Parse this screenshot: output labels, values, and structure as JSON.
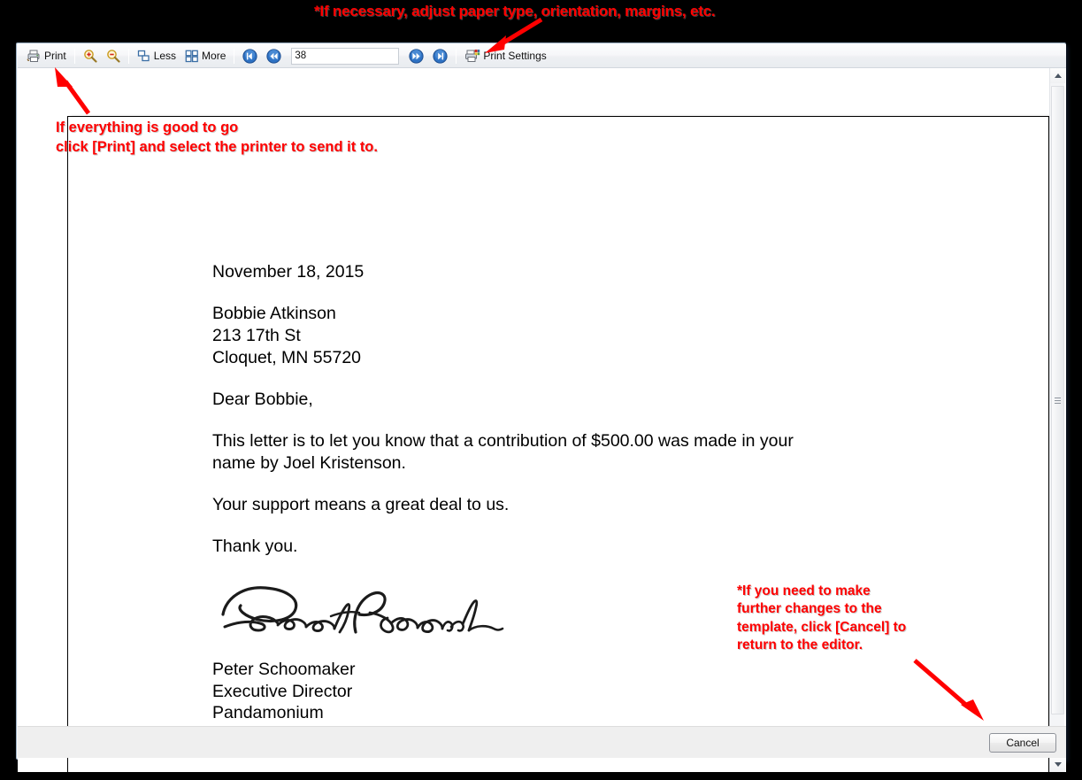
{
  "annotations": {
    "top": "*If necessary, adjust paper type, orientation, margins, etc.",
    "print": "If everything is good to go\nclick [Print] and select the printer to send it to.",
    "cancel": "*If you need to make\nfurther changes to the\ntemplate, click [Cancel] to\nreturn to the editor.",
    "color": "#ff0000"
  },
  "toolbar": {
    "print_label": "Print",
    "zoom_in_icon": "zoom-in-icon",
    "zoom_out_icon": "zoom-out-icon",
    "less_label": "Less",
    "more_label": "More",
    "first_page_icon": "first-page-icon",
    "prev_page_icon": "previous-page-icon",
    "next_page_icon": "next-page-icon",
    "last_page_icon": "last-page-icon",
    "page_number": "38",
    "page_number_placeholder": "",
    "print_settings_label": "Print Settings"
  },
  "letter": {
    "date": "November 18, 2015",
    "recipient": {
      "name": "Bobbie Atkinson",
      "street": "213 17th St",
      "citystatezip": "Cloquet, MN  55720"
    },
    "salutation": "Dear Bobbie,",
    "body_line_1": "This letter is to let you know that a contribution of $500.00 was made in your",
    "body_line_2": "name by Joel Kristenson.",
    "body_paragraph_2": "Your support means a great deal to us.",
    "body_paragraph_3": "Thank you.",
    "signature_alt": "signature-peter-schoomaker",
    "signer": {
      "name": "Peter Schoomaker",
      "title": "Executive Director",
      "organization": "Pandamonium"
    }
  },
  "scrollbar": {
    "up_icon": "scroll-up-arrow-icon",
    "down_icon": "scroll-down-arrow-icon",
    "thumb": "scrollbar-thumb"
  },
  "footer": {
    "cancel_label": "Cancel"
  }
}
